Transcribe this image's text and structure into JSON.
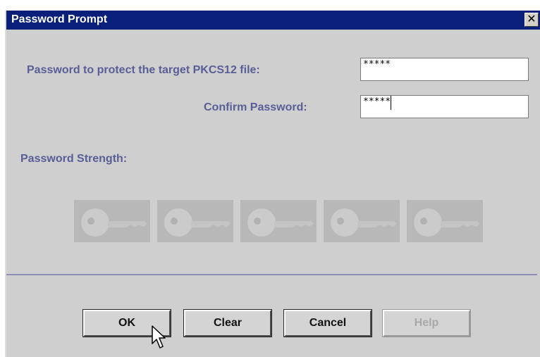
{
  "dialog": {
    "title": "Password Prompt",
    "close_glyph": "✕"
  },
  "form": {
    "password_label": "Password to protect the target PKCS12 file:",
    "password_value": "*****",
    "confirm_label": "Confirm Password:",
    "confirm_value": "*****",
    "strength_label": "Password Strength:",
    "strength_level": 0,
    "strength_max": 5
  },
  "buttons": {
    "ok": "OK",
    "clear": "Clear",
    "cancel": "Cancel",
    "help": "Help"
  },
  "colors": {
    "title_bar": "#0a1f7a",
    "label_text": "#5a5e96",
    "dialog_bg": "#cfcfcf"
  }
}
